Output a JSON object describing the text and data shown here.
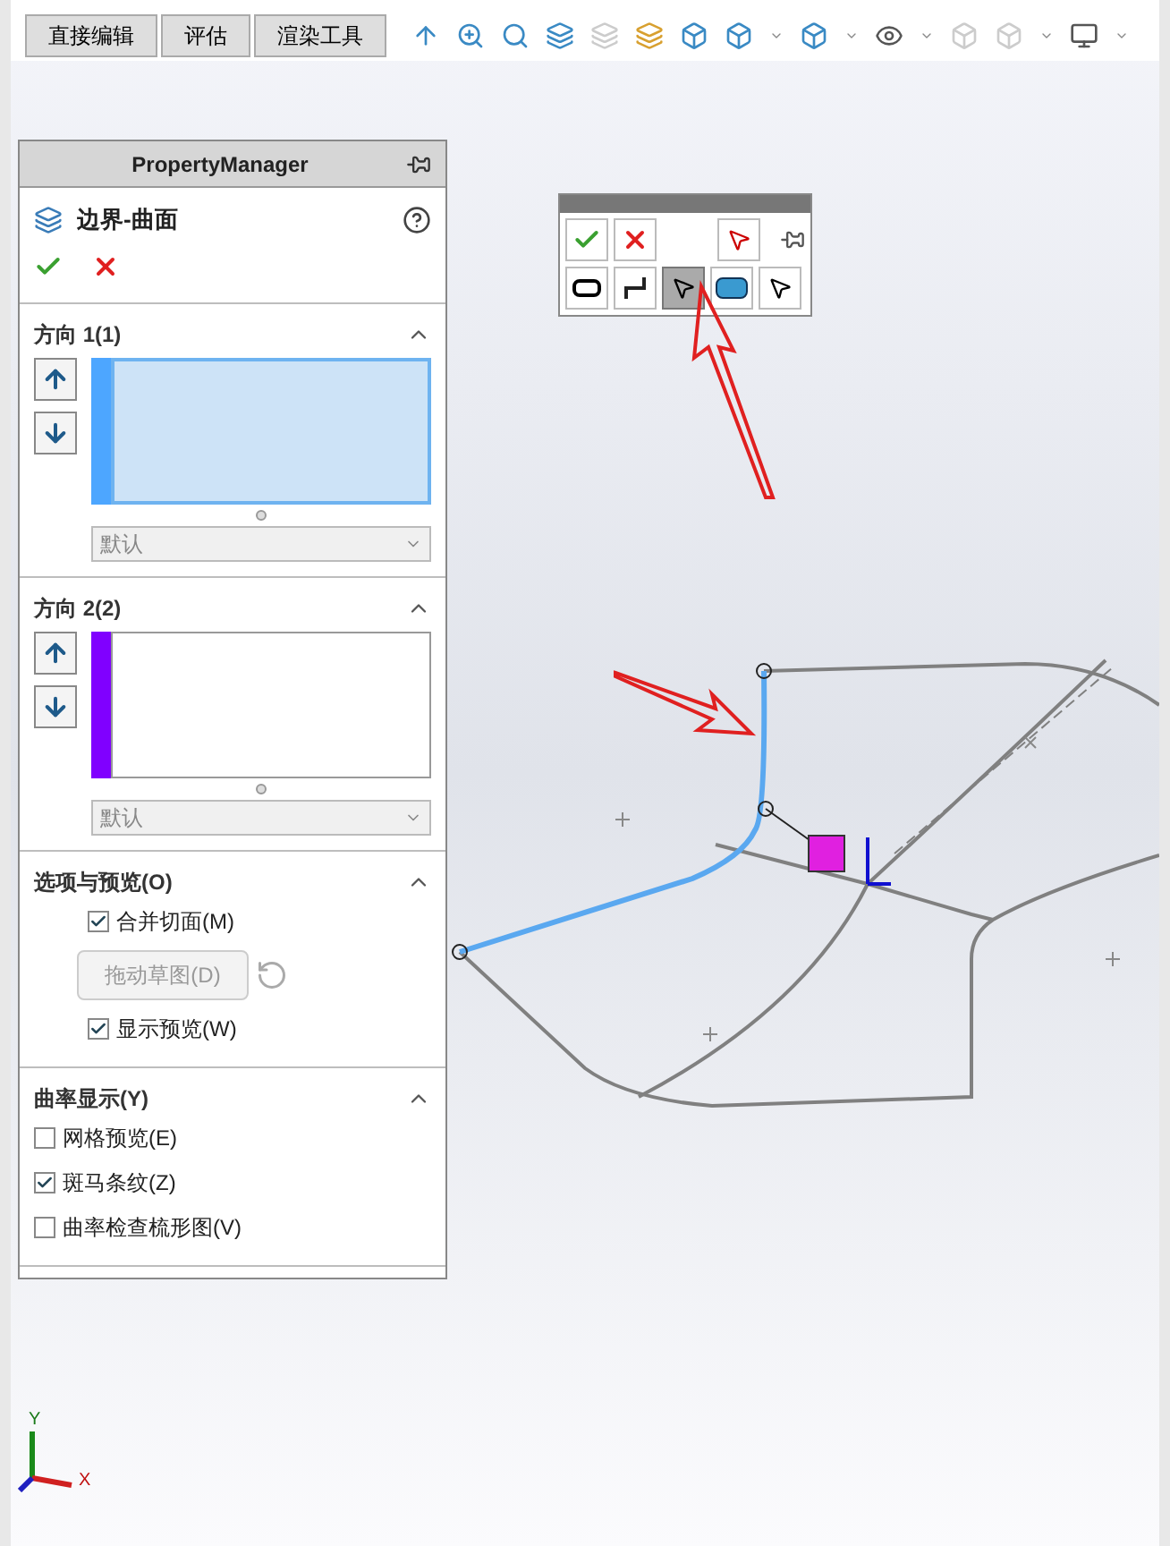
{
  "tabs": [
    {
      "label": "直接编辑",
      "selected": false
    },
    {
      "label": "评估",
      "selected": false
    },
    {
      "label": "渲染工具",
      "selected": false
    }
  ],
  "property_manager": {
    "header": "PropertyManager",
    "feature_title": "边界-曲面",
    "sections": [
      {
        "kind": "direction",
        "title": "方向 1(1)",
        "expanded": true,
        "active": true,
        "color": "#4da6ff",
        "dropdown": "默认"
      },
      {
        "kind": "direction",
        "title": "方向 2(2)",
        "expanded": true,
        "active": false,
        "color": "#8000ff",
        "dropdown": "默认"
      },
      {
        "kind": "options",
        "title": "选项与预览(O)",
        "expanded": true,
        "items": [
          {
            "kind": "checkbox",
            "label": "合并切面(M)",
            "checked": true
          },
          {
            "kind": "button",
            "label": "拖动草图(D)",
            "disabled": true
          },
          {
            "kind": "checkbox",
            "label": "显示预览(W)",
            "checked": true
          }
        ]
      },
      {
        "kind": "options",
        "title": "曲率显示(Y)",
        "expanded": true,
        "items": [
          {
            "kind": "flatcheckbox",
            "label": "网格预览(E)",
            "checked": false
          },
          {
            "kind": "flatcheckbox",
            "label": "斑马条纹(Z)",
            "checked": true
          },
          {
            "kind": "flatcheckbox",
            "label": "曲率检查梳形图(V)",
            "checked": false
          }
        ]
      }
    ]
  },
  "popup_toolbar": {
    "tools": [
      {
        "selected": false
      },
      {
        "selected": false
      },
      {
        "selected": true
      },
      {
        "selected": false
      },
      {
        "selected": false
      }
    ]
  },
  "triad": {
    "y_label": "Y",
    "x_label": "X"
  }
}
